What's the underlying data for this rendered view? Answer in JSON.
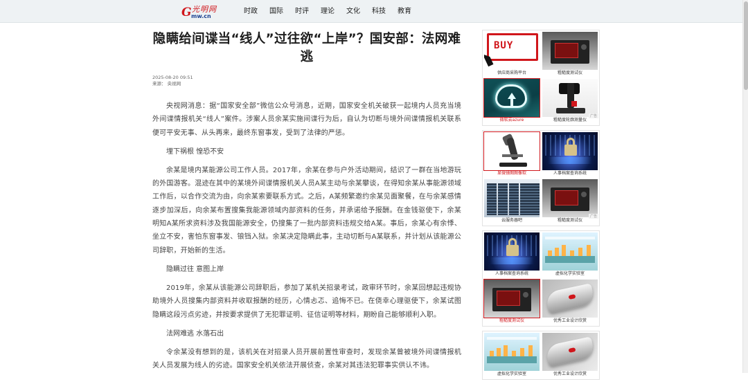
{
  "header": {
    "logo_g": "G",
    "logo_script": "光明网",
    "logo_sub": "mw.cn",
    "nav": [
      "时政",
      "国际",
      "时评",
      "理论",
      "文化",
      "科技",
      "教育"
    ]
  },
  "article": {
    "title": "隐瞒给间谍当“线人”过往欲“上岸”？国安部：法网难逃",
    "date": "2025-08-20 09:51",
    "source": "来源：  央视网",
    "paragraphs": [
      "央视网消息：据“国家安全部”微信公众号消息，近期，国家安全机关破获一起境内人员充当境外间谍情报机关“线人”案件。涉案人员余某实施间谍行为后，自认为切断与境外间谍情报机关联系便可平安无事、从头再来，最终东窗事发，受到了法律的严惩。",
      "埋下祸根 惶恐不安",
      "余某是境内某能源公司工作人员。2017年，余某在参与户外活动期间，结识了一群在当地游玩的外国游客。混迹在其中的某境外间谍情报机关人员A某主动与余某攀谈，在得知余某从事能源领域工作后，以合作交流为由，向余某索要联系方式。之后，A某频繁邀约余某见面聚餐，在与余某感情逐步加深后，向余某布置搜集我能源领域内部资料的任务，并承诺给予报酬。在金钱驱使下，余某明知A某所求资料涉及我国能源安全，仍搜集了一批内部资料违规交给A某。事后，余某心有余悸、坐立不安，害怕东窗事发、锒铛入狱。余某决定隐瞒此事，主动切断与A某联系，并计划从该能源公司辞职，开始新的生活。",
      "隐瞒过往 意图上岸",
      "2019年，余某从该能源公司辞职后，参加了某机关招录考试，政审环节时，余某回想起违规协助境外人员搜集内部资料并收取报酬的经历，心情忐忑、追悔不已。在侥幸心理驱使下，余某试图隐瞒这段污点劣迹，并按要求提供了无犯罪证明、征信证明等材料，期盼自己能够顺利入职。",
      "法网难逃 水落石出",
      "令余某没有想到的是，该机关在对招录人员开展前置性审查时，发现余某曾被境外间谍情报机关人员发展为线人的劣迹。国家安全机关依法开展侦查，余某对其违法犯罪事实供认不讳。"
    ]
  },
  "sidebar": {
    "ad_tag": "广告",
    "groups": [
      {
        "cards": [
          {
            "label": "供应商采购平台",
            "img": "buy",
            "buy_text": "BUY",
            "highlight": false
          },
          {
            "label": "粗糙度测试仪",
            "img": "inst",
            "highlight": false
          },
          {
            "label": "微软云azure",
            "img": "cloud",
            "highlight": true
          },
          {
            "label": "粗糙度轮廓测量仪",
            "img": "mic",
            "highlight": false
          }
        ]
      },
      {
        "cards": [
          {
            "label": "显微镜图图像软",
            "img": "scope",
            "highlight": true
          },
          {
            "label": "人事档案查询系统",
            "img": "lock",
            "highlight": false
          },
          {
            "label": "云服务器吧",
            "img": "server",
            "highlight": false
          },
          {
            "label": "粗糙度测试仪",
            "img": "inst",
            "highlight": false
          }
        ]
      },
      {
        "cards": [
          {
            "label": "人事档案查询系统",
            "img": "lock",
            "highlight": false
          },
          {
            "label": "虚拟化学实验室",
            "img": "chem",
            "highlight": false
          },
          {
            "label": "粗糙度测试仪",
            "img": "inst",
            "highlight": true
          },
          {
            "label": "优秀工业设计欣赏",
            "img": "design",
            "highlight": false
          }
        ]
      },
      {
        "cards": [
          {
            "label": "虚拟化学实验室",
            "img": "chem",
            "highlight": false
          },
          {
            "label": "优秀工业设计欣赏",
            "img": "design",
            "highlight": false
          }
        ]
      }
    ]
  },
  "colors": {
    "brand": "#d0161b",
    "topbar": "#eef2f4",
    "text": "#444444"
  }
}
